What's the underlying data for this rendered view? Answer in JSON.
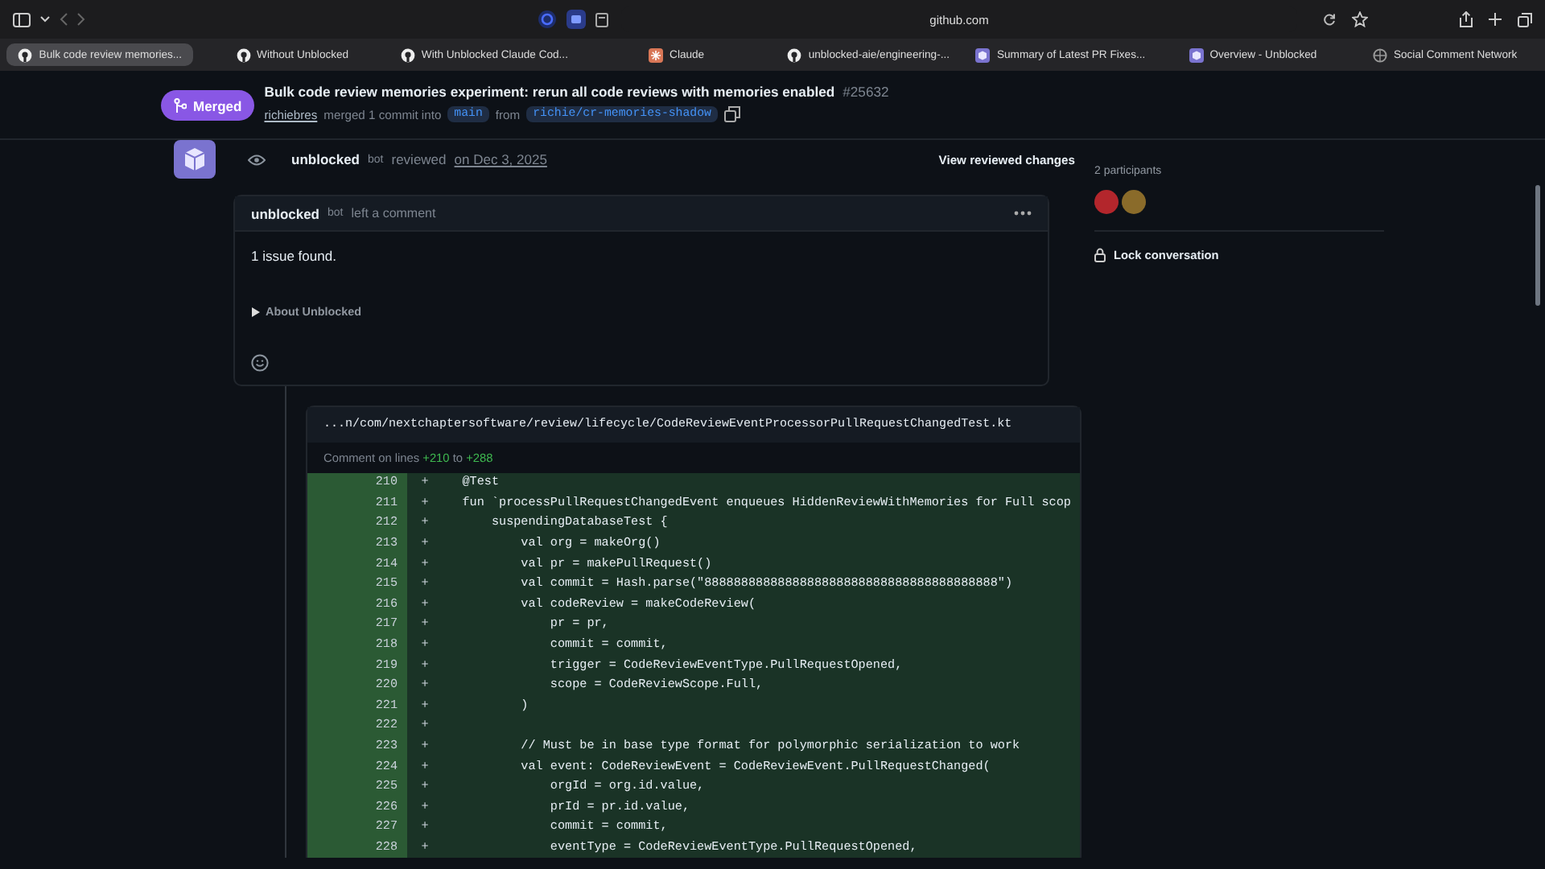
{
  "browser": {
    "address": "github.com",
    "tabs": [
      {
        "title": "Bulk code review memories...",
        "kind": "github",
        "selected": true
      },
      {
        "title": "Without Unblocked",
        "kind": "github",
        "selected": false
      },
      {
        "title": "With Unblocked Claude Cod...",
        "kind": "github",
        "selected": false
      },
      {
        "title": "Claude",
        "kind": "claude",
        "selected": false
      },
      {
        "title": "unblocked-aie/engineering-...",
        "kind": "github",
        "selected": false
      },
      {
        "title": "Summary of Latest PR Fixes...",
        "kind": "unblocked",
        "selected": false
      },
      {
        "title": "Overview - Unblocked",
        "kind": "unblocked",
        "selected": false
      },
      {
        "title": "Social Comment Network",
        "kind": "globe",
        "selected": false
      }
    ]
  },
  "pr": {
    "state": "Merged",
    "title": "Bulk code review memories experiment: rerun all code reviews with memories enabled",
    "number": "#25632",
    "author": "richiebres",
    "merge_text": "merged 1 commit into",
    "base": "main",
    "from_text": "from",
    "head": "richie/cr-memories-shadow"
  },
  "review": {
    "user": "unblocked",
    "badge": "bot",
    "action": "reviewed",
    "date": "on Dec 3, 2025",
    "view_button": "View reviewed changes"
  },
  "comment": {
    "user": "unblocked",
    "badge": "bot",
    "action": "left a comment",
    "body": "1 issue found.",
    "details": {
      "summary": "About Unblocked",
      "expanded": false
    }
  },
  "code": {
    "path": "...n/com/nextchaptersoftware/review/lifecycle/CodeReviewEventProcessorPullRequestChangedTest.kt",
    "range_label": "Comment on lines",
    "range_start": "+210",
    "range_to": "to",
    "range_end": "+288",
    "lines": [
      {
        "number": "210",
        "sign": "+",
        "text": "    @Test"
      },
      {
        "number": "211",
        "sign": "+",
        "text": "    fun `processPullRequestChangedEvent enqueues HiddenReviewWithMemories for Full scop"
      },
      {
        "number": "212",
        "sign": "+",
        "text": "        suspendingDatabaseTest {"
      },
      {
        "number": "213",
        "sign": "+",
        "text": "            val org = makeOrg()"
      },
      {
        "number": "214",
        "sign": "+",
        "text": "            val pr = makePullRequest()"
      },
      {
        "number": "215",
        "sign": "+",
        "text": "            val commit = Hash.parse(\"8888888888888888888888888888888888888888\")"
      },
      {
        "number": "216",
        "sign": "+",
        "text": "            val codeReview = makeCodeReview("
      },
      {
        "number": "217",
        "sign": "+",
        "text": "                pr = pr,"
      },
      {
        "number": "218",
        "sign": "+",
        "text": "                commit = commit,"
      },
      {
        "number": "219",
        "sign": "+",
        "text": "                trigger = CodeReviewEventType.PullRequestOpened,"
      },
      {
        "number": "220",
        "sign": "+",
        "text": "                scope = CodeReviewScope.Full,"
      },
      {
        "number": "221",
        "sign": "+",
        "text": "            )"
      },
      {
        "number": "222",
        "sign": "+"
      },
      {
        "number": "223",
        "sign": "+",
        "text": "            // Must be in base type format for polymorphic serialization to work"
      },
      {
        "number": "224",
        "sign": "+",
        "text": "            val event: CodeReviewEvent = CodeReviewEvent.PullRequestChanged("
      },
      {
        "number": "225",
        "sign": "+",
        "text": "                orgId = org.id.value,"
      },
      {
        "number": "226",
        "sign": "+",
        "text": "                prId = pr.id.value,"
      },
      {
        "number": "227",
        "sign": "+",
        "text": "                commit = commit,"
      },
      {
        "number": "228",
        "sign": "+",
        "text": "                eventType = CodeReviewEventType.PullRequestOpened,"
      }
    ]
  },
  "sidebar": {
    "participants_label": "2 participants",
    "participants": [
      {
        "color": "#b3262c"
      },
      {
        "color": "#8a6b2a"
      }
    ],
    "lock": "Lock conversation"
  }
}
